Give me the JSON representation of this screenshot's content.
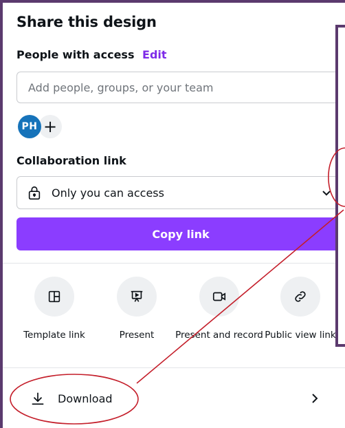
{
  "panel": {
    "title": "Share this design",
    "people_label": "People with access",
    "edit_label": "Edit",
    "input_placeholder": "Add people, groups, or your team",
    "avatar_initials": "PH",
    "add_symbol": "+",
    "collab_label": "Collaboration link",
    "access_value": "Only you can access",
    "copy_label": "Copy link"
  },
  "actions": [
    {
      "label": "Template link",
      "icon": "template-icon"
    },
    {
      "label": "Present",
      "icon": "present-icon"
    },
    {
      "label": "Present and record",
      "icon": "video-camera-icon"
    },
    {
      "label": "Public view link",
      "icon": "link-icon"
    }
  ],
  "download": {
    "label": "Download",
    "icon": "download-icon"
  },
  "colors": {
    "accent": "#8b3dff",
    "edit_link": "#7d2ae8",
    "avatar": "#1673ba",
    "annotation": "#c41e2a",
    "frame": "#5b3a6e"
  }
}
